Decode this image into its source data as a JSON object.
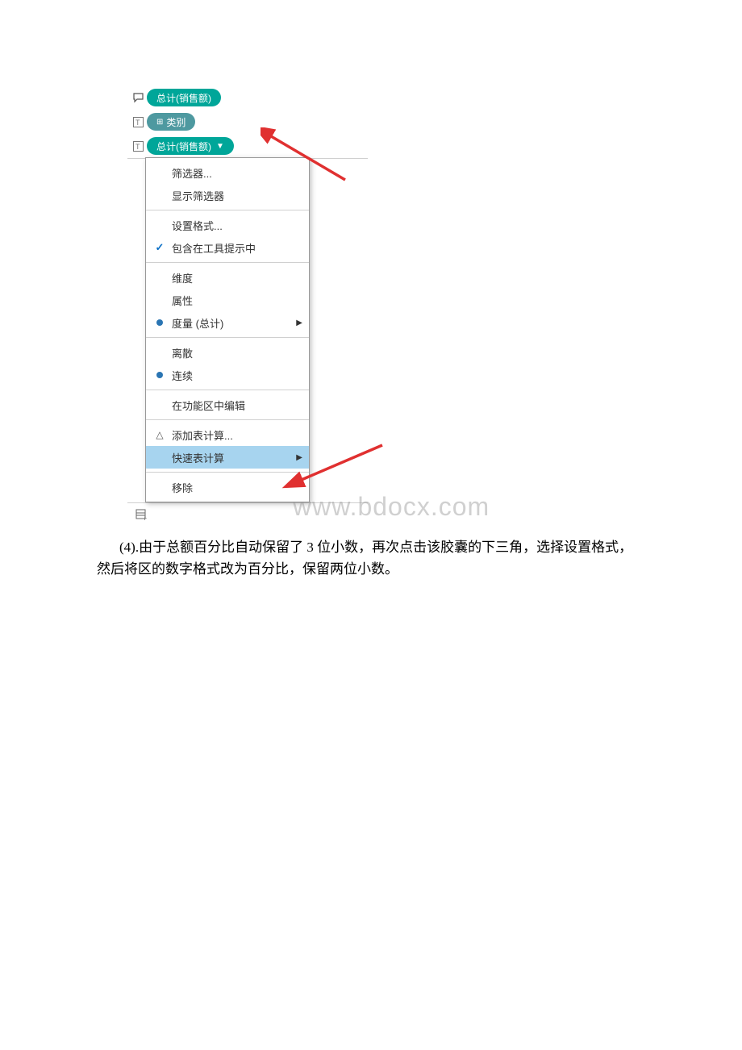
{
  "screenshot": {
    "pills": {
      "tooltip_pill_label": "总计(销售额)",
      "label_pill_label": "类别",
      "text_pill_label": "总计(销售额)"
    },
    "menu": {
      "filter": "筛选器...",
      "show_filter": "显示筛选器",
      "set_format": "设置格式...",
      "include_tooltip": "包含在工具提示中",
      "dimension": "维度",
      "attribute": "属性",
      "measure_total": "度量 (总计)",
      "discrete": "离散",
      "continuous": "连续",
      "edit_in_shelf": "在功能区中编辑",
      "add_table_calc": "添加表计算...",
      "quick_table_calc": "快速表计算",
      "remove": "移除"
    },
    "watermark": "www.bdocx.com"
  },
  "body": {
    "text_prefix": "(4).",
    "text": "由于总额百分比自动保留了 3 位小数，再次点击该胶囊的下三角，选择设置格式，然后将区的数字格式改为百分比，保留两位小数。"
  }
}
